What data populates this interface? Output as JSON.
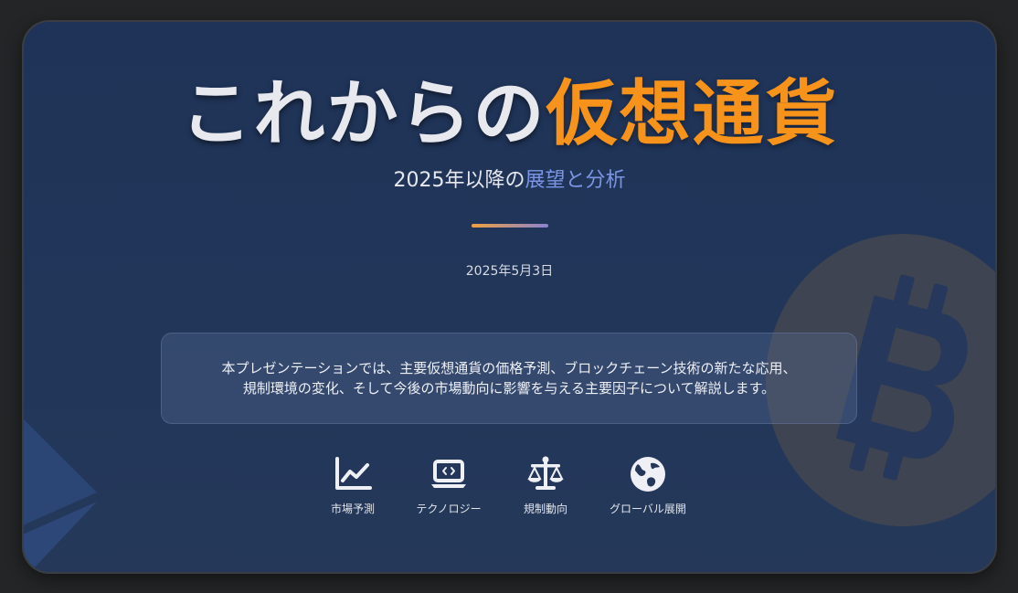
{
  "slide": {
    "title_main": "これからの",
    "title_accent": "仮想通貨",
    "subtitle_main": "2025年以降の",
    "subtitle_accent": "展望と分析",
    "date": "2025年5月3日",
    "description_line1": "本プレゼンテーションでは、主要仮想通貨の価格予測、ブロックチェーン技術の新たな応用、",
    "description_line2": "規制環境の変化、そして今後の市場動向に影響を与える主要因子について解説します。"
  },
  "features": [
    {
      "label": "市場予測",
      "icon": "chart-line-icon"
    },
    {
      "label": "テクノロジー",
      "icon": "laptop-code-icon"
    },
    {
      "label": "規制動向",
      "icon": "balance-scale-icon"
    },
    {
      "label": "グローバル展開",
      "icon": "globe-icon"
    }
  ],
  "colors": {
    "background": "#1f3358",
    "accent_orange": "#f7931a",
    "accent_blue": "#7b95e6",
    "text": "#e8e9ee"
  },
  "decorations": [
    "bitcoin-icon",
    "ethereum-icon"
  ]
}
